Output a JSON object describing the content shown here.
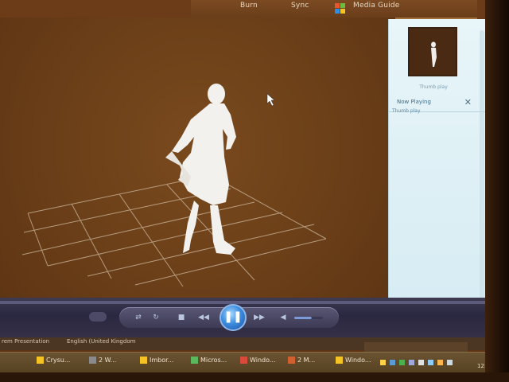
{
  "app": {
    "top_tabs": [
      "Burn",
      "Sync",
      "Media Guide"
    ]
  },
  "panel": {
    "thumbnail_caption": "Thumb play",
    "now_playing_label": "Now Playing",
    "close_glyph": "✕",
    "item_label": "Thumb play"
  },
  "controls": {
    "play_state": "pause",
    "play_glyph": "❚❚",
    "prev_glyph": "◀◀",
    "next_glyph": "▶▶",
    "stop_glyph": "■",
    "volume_level": 0.6
  },
  "status": {
    "left_text": "rem Presentation",
    "mid_text": "English (United Kingdom"
  },
  "taskbar": {
    "items": [
      "Crysu...",
      "2 W...",
      "Imbor...",
      "Micros...",
      "Windo...",
      "2 M...",
      "Windo..."
    ]
  },
  "colors": {
    "video_bg": "#6b3f18",
    "panel_bg": "#e8f5f9",
    "control_bar": "#2a2840",
    "play_button": "#3f8fe0",
    "figure": "#f3f1ee",
    "grid": "#c9b39a"
  },
  "icons": {
    "logo": "windows-flag-icon",
    "cursor": "mouse-pointer-icon",
    "close": "close-icon"
  }
}
